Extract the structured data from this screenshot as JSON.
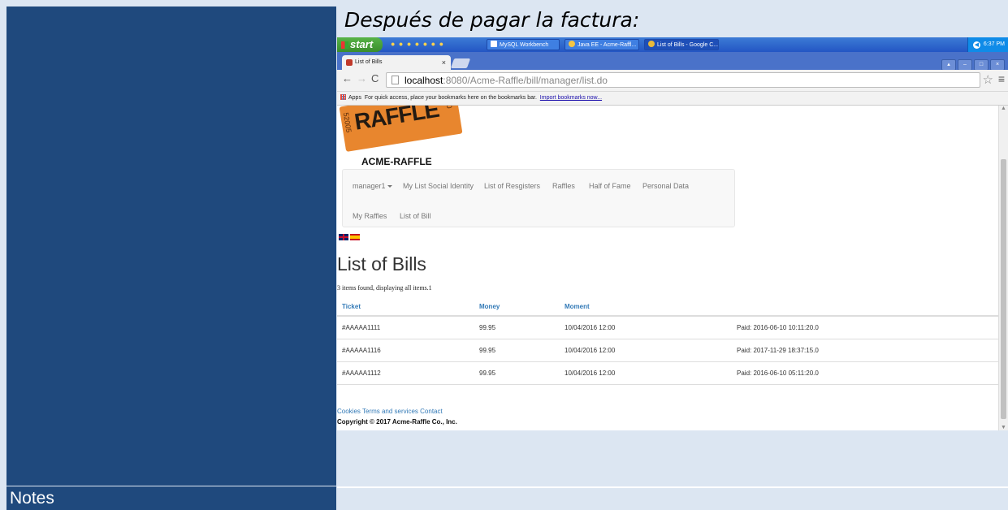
{
  "slide": {
    "heading": "Después de pagar la factura:",
    "notes_label": "Notes"
  },
  "taskbar": {
    "start_label": "start",
    "tasks": [
      {
        "label": "MySQL Workbench"
      },
      {
        "label": "Java EE - Acme-Raffl..."
      },
      {
        "label": "List of Bills - Google C..."
      }
    ],
    "clock": "6:37 PM"
  },
  "browser": {
    "tab_title": "List of Bills",
    "url_host": "localhost",
    "url_path": ":8080/Acme-Raffle/bill/manager/list.do",
    "bookmarks_apps": "Apps",
    "bookmarks_hint": "For quick access, place your bookmarks here on the bookmarks bar.",
    "bookmarks_import": "Import bookmarks now..."
  },
  "site": {
    "logo_text": "RAFFLE",
    "logo_num_left": "52005",
    "logo_num_right": "250",
    "name": "ACME-RAFFLE",
    "nav": {
      "user_menu": "manager1",
      "items": [
        "My List Social Identity",
        "List of Resgisters",
        "Raffles",
        "Half of Fame",
        "Personal Data"
      ],
      "items_row2": [
        "My Raffles",
        "List of Bill"
      ]
    }
  },
  "page": {
    "title": "List of Bills",
    "items_found": "3 items found, displaying all items.1"
  },
  "table": {
    "headers": [
      "Ticket",
      "Money",
      "Moment"
    ],
    "rows": [
      {
        "ticket": "#AAAAA1111",
        "money": "99.95",
        "moment": "10/04/2016 12:00",
        "status": "Paid: 2016-06-10 10:11:20.0"
      },
      {
        "ticket": "#AAAAA1116",
        "money": "99.95",
        "moment": "10/04/2016 12:00",
        "status": "Paid: 2017-11-29 18:37:15.0"
      },
      {
        "ticket": "#AAAAA1112",
        "money": "99.95",
        "moment": "10/04/2016 12:00",
        "status": "Paid: 2016-06-10 05:11:20.0"
      }
    ]
  },
  "footer": {
    "cookies": "Cookies",
    "terms": "Terms and services",
    "contact": "Contact",
    "copyright": "Copyright © 2017 Acme-Raffle Co., Inc."
  },
  "colors": {
    "slide_panel": "#1f497d",
    "slide_bg": "#dce6f2",
    "link": "#337ab7",
    "logo_orange": "#e8862e"
  }
}
